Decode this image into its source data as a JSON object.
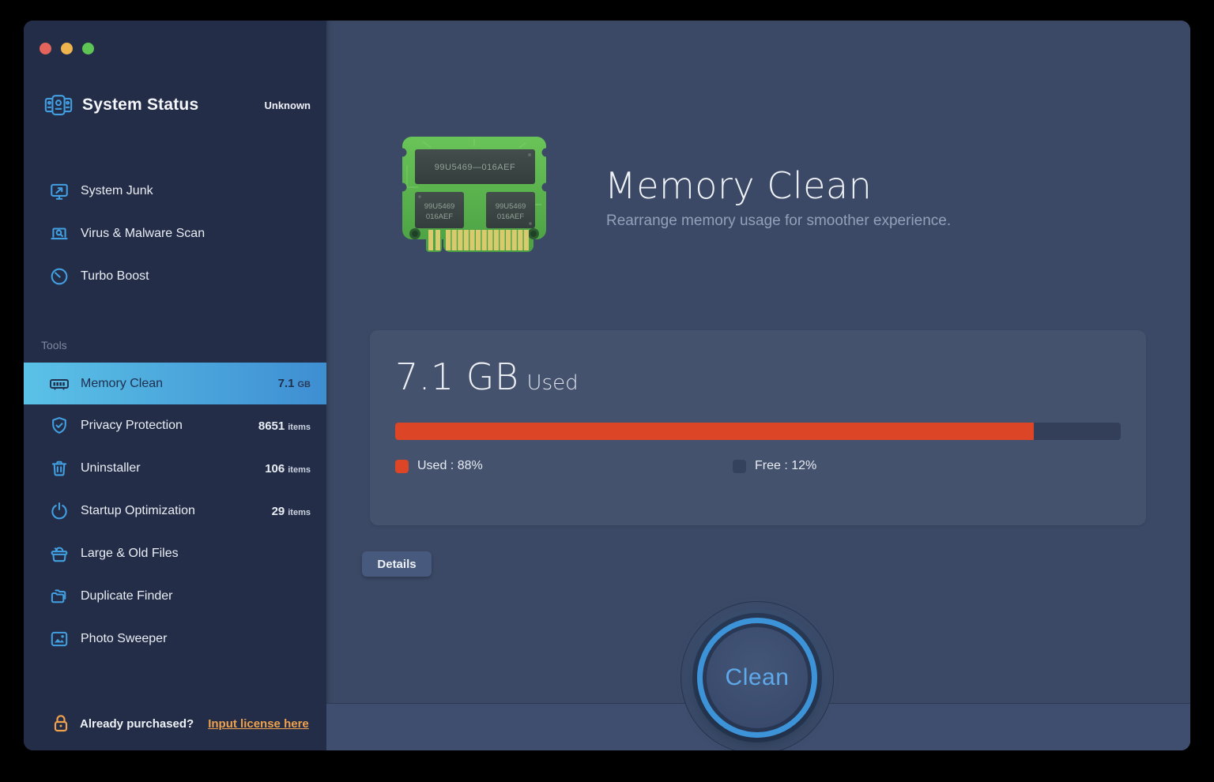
{
  "sidebar": {
    "app": {
      "title": "System Status",
      "status": "Unknown"
    },
    "nav": [
      {
        "label": "System Junk"
      },
      {
        "label": "Virus & Malware Scan"
      },
      {
        "label": "Turbo Boost"
      }
    ],
    "tools_header": "Tools",
    "tools": [
      {
        "label": "Memory Clean",
        "value": "7.1",
        "unit": "GB"
      },
      {
        "label": "Privacy Protection",
        "value": "8651",
        "unit": "items"
      },
      {
        "label": "Uninstaller",
        "value": "106",
        "unit": "items"
      },
      {
        "label": "Startup Optimization",
        "value": "29",
        "unit": "items"
      },
      {
        "label": "Large & Old Files",
        "value": "",
        "unit": ""
      },
      {
        "label": "Duplicate Finder",
        "value": "",
        "unit": ""
      },
      {
        "label": "Photo Sweeper",
        "value": "",
        "unit": ""
      }
    ],
    "license": {
      "prompt": "Already purchased?",
      "link_label": "Input license here"
    }
  },
  "main": {
    "title": "Memory Clean",
    "subtitle": "Rearrange memory usage for smoother experience.",
    "memory_chip": {
      "top_label": "99U5469—016AEF",
      "chip_line1": "99U5469",
      "chip_line2": "016AEF"
    },
    "usage": {
      "amount": "7.1 GB",
      "amount_suffix": "Used",
      "used_percent": 88,
      "free_percent": 12,
      "legend_used": "Used : 88%",
      "legend_free": "Free : 12%"
    },
    "details_label": "Details",
    "clean_label": "Clean"
  },
  "colors": {
    "accent_blue": "#42a0e2",
    "selected_gradient_start": "#5bc2e7",
    "selected_gradient_end": "#3e8ed2",
    "used_red": "#dd4527",
    "license_orange": "#efa14d",
    "sidebar_bg": "#232d47",
    "main_bg": "#3b4966"
  }
}
